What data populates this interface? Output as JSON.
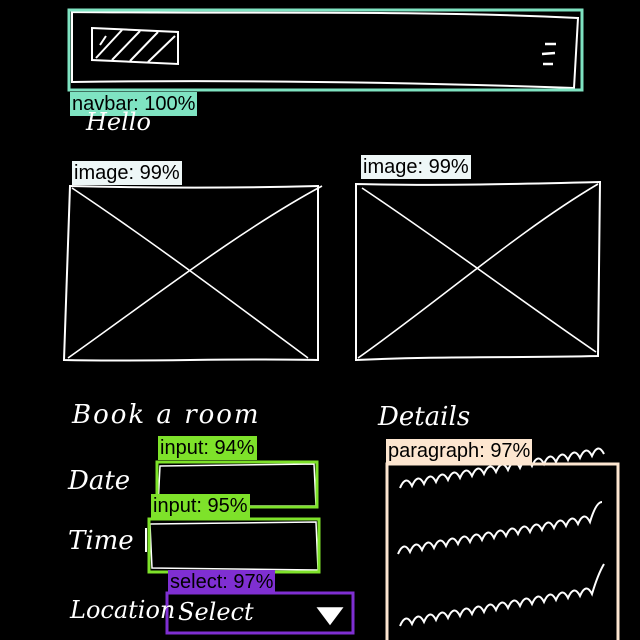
{
  "navbar": {
    "tag_label": "navbar",
    "tag_score": "100%",
    "tag_color": "#7fe3c2",
    "menu_icon": "hamburger-icon",
    "logo_icon": "logo-placeholder"
  },
  "greeting": "Hello",
  "images": [
    {
      "tag_label": "image",
      "tag_score": "99%",
      "icon": "image-placeholder-icon"
    },
    {
      "tag_label": "image",
      "tag_score": "99%",
      "icon": "image-placeholder-icon"
    }
  ],
  "booking": {
    "heading": "Book a room",
    "date_label": "Date",
    "time_label": "Time",
    "location_label": "Location",
    "date_input": {
      "tag_label": "input",
      "tag_score": "94%",
      "value": ""
    },
    "time_input": {
      "tag_label": "input",
      "tag_score": "95%",
      "value": ""
    },
    "location_select": {
      "tag_label": "select",
      "tag_score": "97%",
      "selected": "Select",
      "icon": "triangle-down-icon"
    }
  },
  "details": {
    "heading": "Details",
    "paragraph": {
      "tag_label": "paragraph",
      "tag_score": "97%"
    }
  },
  "colors": {
    "navbar": "#7fe3c2",
    "image": "#eef7f7",
    "input": "#7ee22a",
    "select": "#7f2fd2",
    "paragraph": "#fde6d0",
    "sketch": "#ffffff"
  }
}
